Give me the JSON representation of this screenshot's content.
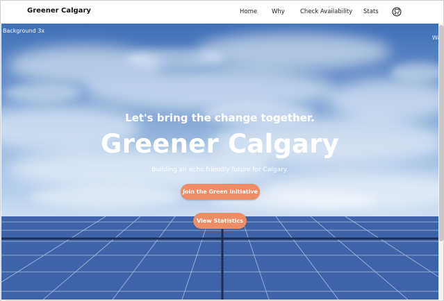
{
  "nav": {
    "brand": "Greener Calgary",
    "links": [
      "Home",
      "Why",
      "Check Availability",
      "Stats"
    ],
    "github_icon": "github-icon"
  },
  "hero": {
    "background_label": "Background 3x",
    "right_edge_text": "Wa",
    "tagline": "Let's bring the change together.",
    "title": "Greener Calgary",
    "subtitle": "Building an echo friendly future for Calgary.",
    "buttons": {
      "join": "Join the Green Initiative",
      "stats": "View Statistics"
    }
  },
  "colors": {
    "accent": "#ee8c66",
    "sky": "#5b86c6",
    "panels": "#3c66ad"
  }
}
